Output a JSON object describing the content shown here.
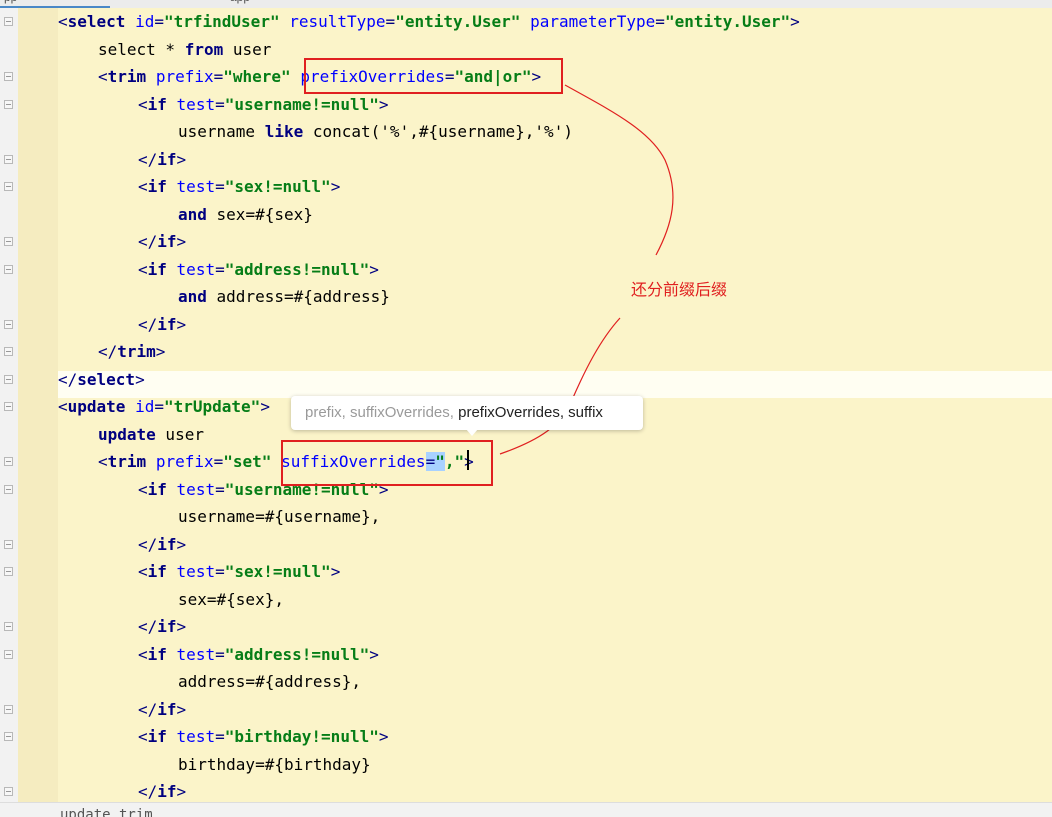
{
  "tabs": [
    "pp",
    "app",
    "",
    "",
    "",
    ""
  ],
  "code": {
    "lines": [
      [
        [
          "tag",
          "<"
        ],
        [
          "tagname",
          "select"
        ],
        [
          "txt",
          " "
        ],
        [
          "attr",
          "id"
        ],
        [
          "tag",
          "="
        ],
        [
          "val",
          "\"trfindUser\""
        ],
        [
          "txt",
          " "
        ],
        [
          "attr",
          "resultType"
        ],
        [
          "tag",
          "="
        ],
        [
          "val",
          "\"entity.User\""
        ],
        [
          "txt",
          " "
        ],
        [
          "attr",
          "parameterType"
        ],
        [
          "tag",
          "="
        ],
        [
          "val",
          "\"entity.User\""
        ],
        [
          "tag",
          ">"
        ]
      ],
      [
        [
          "txt",
          "select * "
        ],
        [
          "kw",
          "from"
        ],
        [
          "txt",
          " user"
        ]
      ],
      [
        [
          "tag",
          "<"
        ],
        [
          "tagname",
          "trim"
        ],
        [
          "txt",
          " "
        ],
        [
          "attr",
          "prefix"
        ],
        [
          "tag",
          "="
        ],
        [
          "val",
          "\"where\""
        ],
        [
          "txt",
          " "
        ],
        [
          "attr",
          "prefixOverrides"
        ],
        [
          "tag",
          "="
        ],
        [
          "val",
          "\"and|or\""
        ],
        [
          "tag",
          ">"
        ]
      ],
      [
        [
          "tag",
          "<"
        ],
        [
          "tagname",
          "if"
        ],
        [
          "txt",
          " "
        ],
        [
          "attr",
          "test"
        ],
        [
          "tag",
          "="
        ],
        [
          "val",
          "\"username!=null\""
        ],
        [
          "tag",
          ">"
        ]
      ],
      [
        [
          "txt",
          "username "
        ],
        [
          "kw",
          "like"
        ],
        [
          "txt",
          " concat('%',#{username},'%')"
        ]
      ],
      [
        [
          "tag",
          "</"
        ],
        [
          "tagname",
          "if"
        ],
        [
          "tag",
          ">"
        ]
      ],
      [
        [
          "tag",
          "<"
        ],
        [
          "tagname",
          "if"
        ],
        [
          "txt",
          " "
        ],
        [
          "attr",
          "test"
        ],
        [
          "tag",
          "="
        ],
        [
          "val",
          "\"sex!=null\""
        ],
        [
          "tag",
          ">"
        ]
      ],
      [
        [
          "kw",
          "and"
        ],
        [
          "txt",
          " sex=#{sex}"
        ]
      ],
      [
        [
          "tag",
          "</"
        ],
        [
          "tagname",
          "if"
        ],
        [
          "tag",
          ">"
        ]
      ],
      [
        [
          "tag",
          "<"
        ],
        [
          "tagname",
          "if"
        ],
        [
          "txt",
          " "
        ],
        [
          "attr",
          "test"
        ],
        [
          "tag",
          "="
        ],
        [
          "val",
          "\"address!=null\""
        ],
        [
          "tag",
          ">"
        ]
      ],
      [
        [
          "kw",
          "and"
        ],
        [
          "txt",
          " address=#{address}"
        ]
      ],
      [
        [
          "tag",
          "</"
        ],
        [
          "tagname",
          "if"
        ],
        [
          "tag",
          ">"
        ]
      ],
      [
        [
          "tag",
          "</"
        ],
        [
          "tagname",
          "trim"
        ],
        [
          "tag",
          ">"
        ]
      ],
      [
        [
          "tag",
          "</"
        ],
        [
          "tagname",
          "select"
        ],
        [
          "tag",
          ">"
        ]
      ],
      [
        [
          "tag",
          "<"
        ],
        [
          "tagname",
          "update"
        ],
        [
          "txt",
          " "
        ],
        [
          "attr",
          "id"
        ],
        [
          "tag",
          "="
        ],
        [
          "val",
          "\"trUpdate\""
        ],
        [
          "tag",
          ">"
        ]
      ],
      [
        [
          "kw",
          "update"
        ],
        [
          "txt",
          " user"
        ]
      ],
      [
        [
          "tag",
          "<"
        ],
        [
          "tagname",
          "trim"
        ],
        [
          "txt",
          " "
        ],
        [
          "attr",
          "prefix"
        ],
        [
          "tag",
          "="
        ],
        [
          "val",
          "\"set\""
        ],
        [
          "txt",
          " "
        ],
        [
          "attr",
          "suffixOverrides"
        ],
        [
          "tag",
          "="
        ],
        [
          "val",
          "\""
        ],
        [
          "val",
          ","
        ],
        [
          "val",
          "\""
        ],
        [
          "tag",
          ">"
        ]
      ],
      [
        [
          "tag",
          "<"
        ],
        [
          "tagname",
          "if"
        ],
        [
          "txt",
          " "
        ],
        [
          "attr",
          "test"
        ],
        [
          "tag",
          "="
        ],
        [
          "val",
          "\"username!=null\""
        ],
        [
          "tag",
          ">"
        ]
      ],
      [
        [
          "txt",
          "username=#{username},"
        ]
      ],
      [
        [
          "tag",
          "</"
        ],
        [
          "tagname",
          "if"
        ],
        [
          "tag",
          ">"
        ]
      ],
      [
        [
          "tag",
          "<"
        ],
        [
          "tagname",
          "if"
        ],
        [
          "txt",
          " "
        ],
        [
          "attr",
          "test"
        ],
        [
          "tag",
          "="
        ],
        [
          "val",
          "\"sex!=null\""
        ],
        [
          "tag",
          ">"
        ]
      ],
      [
        [
          "txt",
          "sex=#{sex},"
        ]
      ],
      [
        [
          "tag",
          "</"
        ],
        [
          "tagname",
          "if"
        ],
        [
          "tag",
          ">"
        ]
      ],
      [
        [
          "tag",
          "<"
        ],
        [
          "tagname",
          "if"
        ],
        [
          "txt",
          " "
        ],
        [
          "attr",
          "test"
        ],
        [
          "tag",
          "="
        ],
        [
          "val",
          "\"address!=null\""
        ],
        [
          "tag",
          ">"
        ]
      ],
      [
        [
          "txt",
          "address=#{address},"
        ]
      ],
      [
        [
          "tag",
          "</"
        ],
        [
          "tagname",
          "if"
        ],
        [
          "tag",
          ">"
        ]
      ],
      [
        [
          "tag",
          "<"
        ],
        [
          "tagname",
          "if"
        ],
        [
          "txt",
          " "
        ],
        [
          "attr",
          "test"
        ],
        [
          "tag",
          "="
        ],
        [
          "val",
          "\"birthday!=null\""
        ],
        [
          "tag",
          ">"
        ]
      ],
      [
        [
          "txt",
          "birthday=#{birthday}"
        ]
      ],
      [
        [
          "tag",
          "</"
        ],
        [
          "tagname",
          "if"
        ],
        [
          "tag",
          ">"
        ]
      ]
    ]
  },
  "annotation": {
    "note": "还分前缀后缀",
    "color": "#e02020"
  },
  "completion_popup": {
    "dim_items": "prefix, suffixOverrides,",
    "items": "prefixOverrides, suffix"
  },
  "bottom_bar": {
    "breadcrumb": "update  trim"
  },
  "colors": {
    "editor_bg": "#fbf4c9",
    "tag": "#000080",
    "attribute": "#0000ff",
    "value": "#067d17",
    "highlight": "#a8d1ff"
  }
}
